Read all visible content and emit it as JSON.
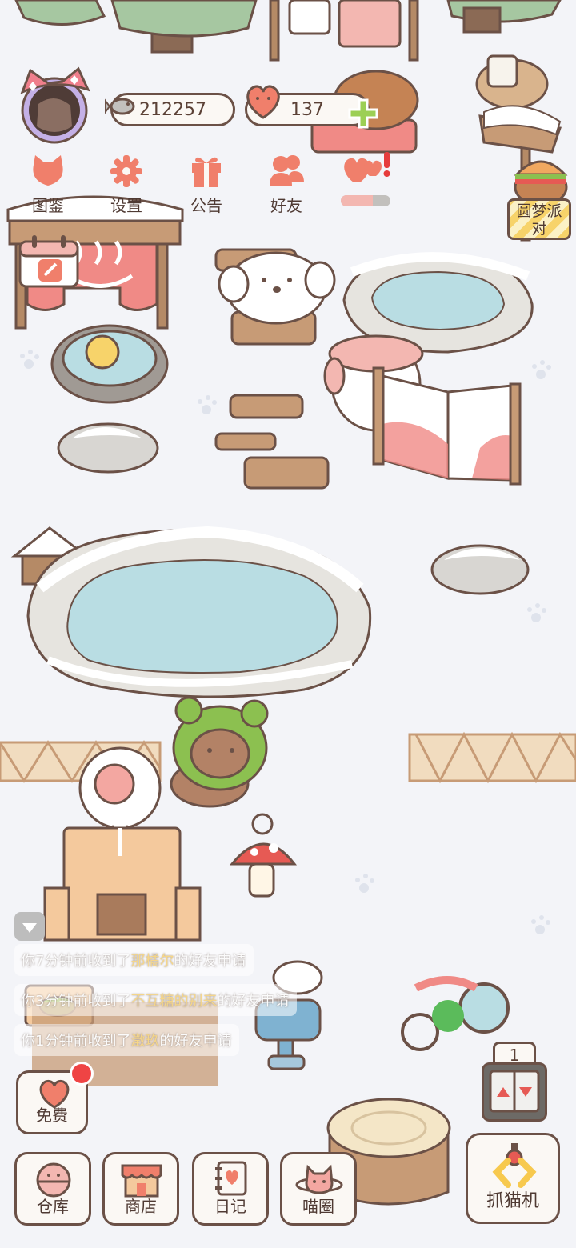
{
  "resources": {
    "fish": "212257",
    "hearts": "137"
  },
  "top_menu": [
    {
      "label": "图鉴",
      "icon": "cat-head-icon"
    },
    {
      "label": "设置",
      "icon": "gear-icon"
    },
    {
      "label": "公告",
      "icon": "gift-icon"
    },
    {
      "label": "好友",
      "icon": "friends-icon"
    },
    {
      "label": "",
      "icon": "hearts-alert-icon"
    }
  ],
  "event": {
    "label": "圆梦派对"
  },
  "chat": {
    "messages": [
      {
        "prefix": "你7分钟前收到了",
        "name": "那橘尔",
        "suffix": "的好友申请"
      },
      {
        "prefix": "你3分钟前收到了",
        "name": "不互糖的别来",
        "suffix": "的好友申请"
      },
      {
        "prefix": "你1分钟前收到了",
        "name": "澂玖",
        "suffix": "的好友申请"
      }
    ]
  },
  "free_button": {
    "label": "免费"
  },
  "bottom_nav": [
    {
      "label": "仓库",
      "icon": "bowl-icon"
    },
    {
      "label": "商店",
      "icon": "shop-icon"
    },
    {
      "label": "日记",
      "icon": "diary-icon"
    },
    {
      "label": "喵圈",
      "icon": "planet-cat-icon"
    }
  ],
  "claw": {
    "label": "抓猫机"
  },
  "elevator": {
    "floor": "1"
  },
  "colors": {
    "outline": "#6b5147",
    "accent": "#f07f6b",
    "water": "#b9dde3",
    "wood": "#c79b76",
    "snow": "#ffffff",
    "background": "#f3f4f8"
  }
}
